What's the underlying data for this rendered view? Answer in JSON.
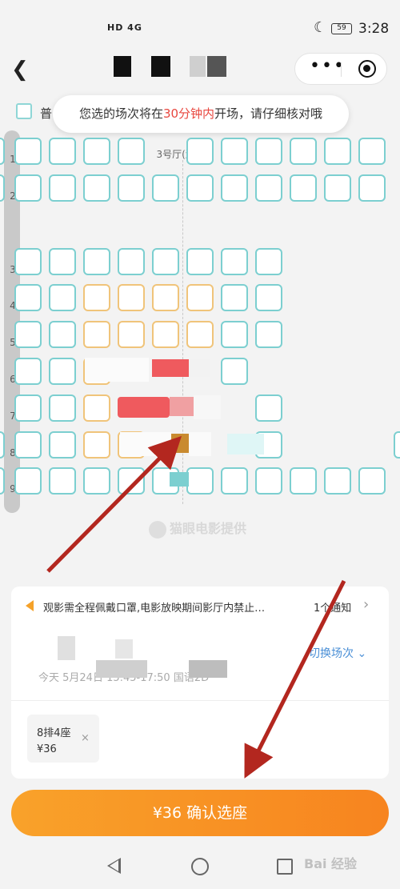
{
  "status_bar": {
    "network": "HD 4G",
    "battery": "59",
    "time": "3:28"
  },
  "legend": {
    "label": "普"
  },
  "toast": {
    "prefix": "您选的场次将在",
    "highlight": "30分钟内",
    "suffix": "开场，请仔细核对哦",
    "highlight_color": "#e8473f"
  },
  "hall": {
    "label": "3号厅(激光)"
  },
  "rows": [
    "1",
    "2",
    "3",
    "4",
    "5",
    "6",
    "7",
    "8",
    "9"
  ],
  "watermark": "猫眼电影提供",
  "notice": {
    "text": "观影需全程佩戴口罩,电影放映期间影厅内禁止…",
    "count": "1个通知"
  },
  "show": {
    "switch_label": "切换场次",
    "time": "今天 5月24日 15:45-17:50 国语2D"
  },
  "selected_ticket": {
    "seat": "8排4座",
    "price": "¥36"
  },
  "confirm_button": {
    "label": "¥36 确认选座",
    "color": "#f7931f"
  },
  "footer_mark": "Bai 经验",
  "colors": {
    "seat_standard_border": "#7ccfd0",
    "seat_vip_border": "#f0c47a",
    "seat_selected": "#c98a2f",
    "annotation_arrow": "#b3271f"
  }
}
